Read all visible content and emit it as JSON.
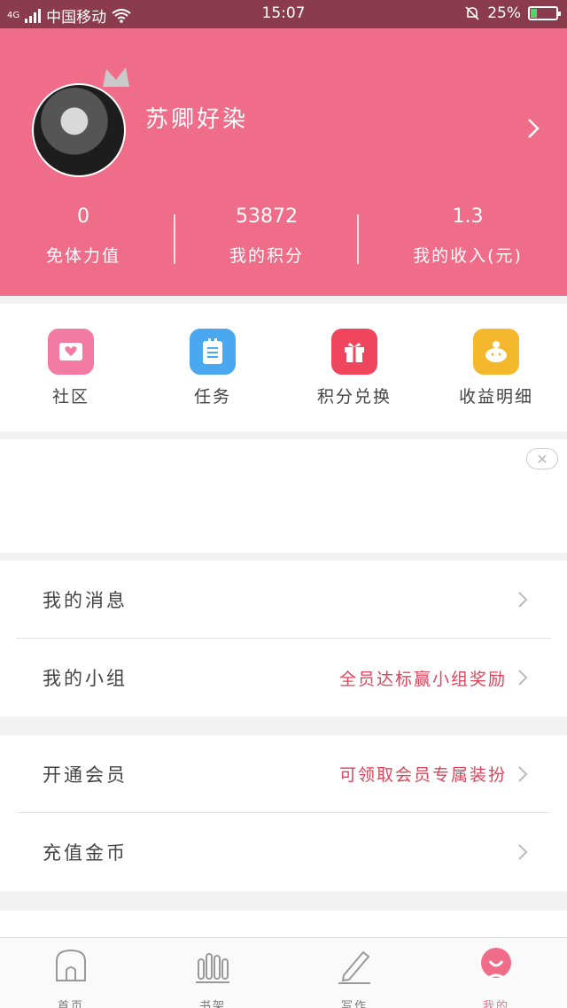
{
  "status_bar": {
    "network": "4G",
    "carrier": "中国移动",
    "time": "15:07",
    "battery": "25%",
    "battery_level": 0.25
  },
  "profile": {
    "username": "苏卿好染",
    "stats": [
      {
        "value": "0",
        "label": "免体力值"
      },
      {
        "value": "53872",
        "label": "我的积分"
      },
      {
        "value": "1.3",
        "label": "我的收入(元)"
      }
    ]
  },
  "quick_actions": [
    {
      "label": "社区",
      "icon": "community-icon",
      "color": "#f27aa3"
    },
    {
      "label": "任务",
      "icon": "task-list-icon",
      "color": "#4aa8f0"
    },
    {
      "label": "积分兑换",
      "icon": "gift-icon",
      "color": "#f0465d"
    },
    {
      "label": "收益明细",
      "icon": "piggy-bank-icon",
      "color": "#f5b82c"
    }
  ],
  "ad": {
    "close_icon": "close-icon"
  },
  "menu_group_1": [
    {
      "title": "我的消息",
      "hint": ""
    },
    {
      "title": "我的小组",
      "hint": "全员达标赢小组奖励"
    }
  ],
  "menu_group_2": [
    {
      "title": "开通会员",
      "hint": "可领取会员专属装扮"
    },
    {
      "title": "充值金币",
      "hint": ""
    }
  ],
  "bottom_nav": [
    {
      "label": "首页",
      "icon": "home-icon"
    },
    {
      "label": "书架",
      "icon": "bookshelf-icon"
    },
    {
      "label": "写作",
      "icon": "pen-icon"
    },
    {
      "label": "我的",
      "icon": "profile-icon",
      "active": true
    }
  ],
  "colors": {
    "brand": "#ef6d89",
    "accent_text": "#e0435a",
    "status_bar": "#8a3b4e"
  }
}
